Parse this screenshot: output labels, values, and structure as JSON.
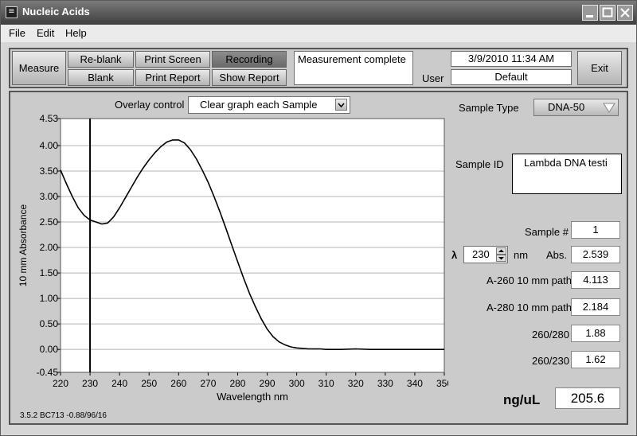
{
  "window": {
    "title": "Nucleic Acids"
  },
  "menu": {
    "file": "File",
    "edit": "Edit",
    "help": "Help"
  },
  "toolbar": {
    "measure": "Measure",
    "reblank": "Re-blank",
    "blank": "Blank",
    "print_screen": "Print Screen",
    "print_report": "Print Report",
    "recording": "Recording",
    "show_report": "Show Report",
    "status": "Measurement complete",
    "datetime": "3/9/2010 11:34 AM",
    "user_label": "User",
    "user_value": "Default",
    "exit": "Exit"
  },
  "overlay": {
    "label": "Overlay control",
    "value": "Clear graph each Sample"
  },
  "sample": {
    "type_label": "Sample Type",
    "type_value": "DNA-50",
    "id_label": "Sample ID",
    "id_value": "Lambda DNA testi",
    "number_label": "Sample #",
    "number_value": "1",
    "lambda_symbol": "λ",
    "lambda_value": "230",
    "lambda_unit": "nm",
    "abs_label": "Abs.",
    "abs_value": "2.539",
    "a260_label": "A-260 10 mm path",
    "a260_value": "4.113",
    "a280_label": "A-280 10 mm path",
    "a280_value": "2.184",
    "r260_280_label": "260/280",
    "r260_280_value": "1.88",
    "r260_230_label": "260/230",
    "r260_230_value": "1.62",
    "conc_label": "ng/uL",
    "conc_value": "205.6"
  },
  "footer": {
    "version": "3.5.2 BC713 -0.88/96/16"
  },
  "chart_data": {
    "type": "line",
    "xlabel": "Wavelength nm",
    "ylabel": "10 mm Absorbance",
    "xlim": [
      220,
      350
    ],
    "ylim": [
      -0.45,
      4.53
    ],
    "xticks": [
      "220",
      "230",
      "240",
      "250",
      "260",
      "270",
      "280",
      "290",
      "300",
      "310",
      "320",
      "330",
      "340",
      "350"
    ],
    "yticks": [
      "4.53",
      "4.00",
      "3.50",
      "3.00",
      "2.50",
      "2.00",
      "1.50",
      "1.00",
      "0.50",
      "0.00",
      "-0.45"
    ],
    "grid": true,
    "cursor_x": 230,
    "series": [
      {
        "x": [
          220,
          222,
          224,
          226,
          228,
          230,
          232,
          234,
          236,
          238,
          240,
          242,
          244,
          246,
          248,
          250,
          252,
          254,
          256,
          258,
          260,
          262,
          264,
          266,
          268,
          270,
          272,
          274,
          276,
          278,
          280,
          282,
          284,
          286,
          288,
          290,
          292,
          294,
          296,
          298,
          300,
          302,
          304,
          306,
          308,
          310,
          315,
          320,
          325,
          330,
          335,
          340,
          345,
          350
        ],
        "y": [
          3.52,
          3.25,
          3.0,
          2.78,
          2.63,
          2.54,
          2.5,
          2.46,
          2.48,
          2.6,
          2.78,
          2.98,
          3.18,
          3.38,
          3.56,
          3.72,
          3.86,
          3.98,
          4.07,
          4.11,
          4.11,
          4.05,
          3.92,
          3.74,
          3.52,
          3.28,
          3.0,
          2.7,
          2.38,
          2.05,
          1.72,
          1.4,
          1.1,
          0.84,
          0.6,
          0.4,
          0.25,
          0.15,
          0.09,
          0.05,
          0.03,
          0.02,
          0.01,
          0.01,
          0.01,
          0.0,
          0.0,
          0.01,
          0.0,
          0.0,
          0.0,
          0.0,
          0.0,
          0.0
        ]
      }
    ]
  }
}
